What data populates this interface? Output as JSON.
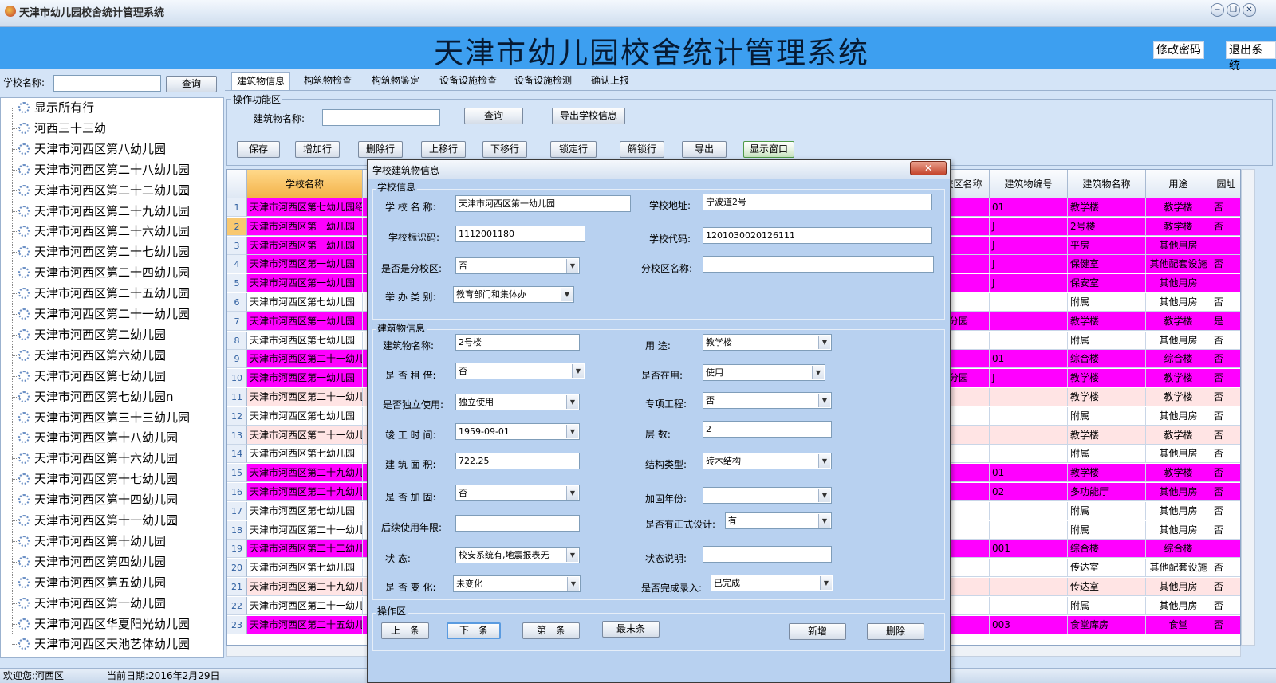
{
  "window": {
    "title": "天津市幼儿园校舍统计管理系统",
    "min": "−",
    "max": "❐",
    "close": "✕"
  },
  "banner": {
    "title": "天津市幼儿园校舍统计管理系统",
    "change_password": "修改密码",
    "logout": "退出系统"
  },
  "left": {
    "school_label": "学校名称:",
    "school_value": "",
    "query": "查询"
  },
  "tree": [
    "显示所有行",
    "河西三十三幼",
    "天津市河西区第八幼儿园",
    "天津市河西区第二十八幼儿园",
    "天津市河西区第二十二幼儿园",
    "天津市河西区第二十九幼儿园",
    "天津市河西区第二十六幼儿园",
    "天津市河西区第二十七幼儿园",
    "天津市河西区第二十四幼儿园",
    "天津市河西区第二十五幼儿园",
    "天津市河西区第二十一幼儿园",
    "天津市河西区第二幼儿园",
    "天津市河西区第六幼儿园",
    "天津市河西区第七幼儿园",
    "天津市河西区第七幼儿园n",
    "天津市河西区第三十三幼儿园",
    "天津市河西区第十八幼儿园",
    "天津市河西区第十六幼儿园",
    "天津市河西区第十七幼儿园",
    "天津市河西区第十四幼儿园",
    "天津市河西区第十一幼儿园",
    "天津市河西区第十幼儿园",
    "天津市河西区第四幼儿园",
    "天津市河西区第五幼儿园",
    "天津市河西区第一幼儿园",
    "天津市河西区华夏阳光幼儿园",
    "天津市河西区天池艺体幼儿园"
  ],
  "tabs": [
    "建筑物信息",
    "构筑物检查",
    "构筑物鉴定",
    "设备设施检查",
    "设备设施检测",
    "确认上报"
  ],
  "ops": {
    "legend": "操作功能区",
    "building_name_label": "建筑物名称:",
    "building_name_value": "",
    "query": "查询",
    "export_school": "导出学校信息",
    "buttons": [
      "保存",
      "增加行",
      "删除行",
      "上移行",
      "下移行",
      "锁定行",
      "解锁行",
      "导出",
      "显示窗口"
    ]
  },
  "grid": {
    "headers": {
      "school": "学校名称",
      "campus": "校区名称",
      "bno": "建筑物编号",
      "bname": "建筑物名称",
      "use": "用途",
      "garden": "园址"
    },
    "rows": [
      {
        "n": "1",
        "school": "天津市河西区第七幼儿园绍",
        "campus": "",
        "bno": "01",
        "bname": "教学楼",
        "use": "教学楼",
        "f": "否",
        "c": "#ff00ff"
      },
      {
        "n": "2",
        "school": "天津市河西区第一幼儿园",
        "campus": "",
        "bno": "J",
        "bname": "2号楼",
        "use": "教学楼",
        "f": "否",
        "c": "#ff00ff"
      },
      {
        "n": "3",
        "school": "天津市河西区第一幼儿园",
        "campus": "",
        "bno": "J",
        "bname": "平房",
        "use": "其他用房",
        "f": "",
        "c": "#ff00ff"
      },
      {
        "n": "4",
        "school": "天津市河西区第一幼儿园",
        "campus": "",
        "bno": "J",
        "bname": "保健室",
        "use": "其他配套设施",
        "f": "否",
        "c": "#ff00ff"
      },
      {
        "n": "5",
        "school": "天津市河西区第一幼儿园",
        "campus": "",
        "bno": "J",
        "bname": "保安室",
        "use": "其他用房",
        "f": "",
        "c": "#ff00ff"
      },
      {
        "n": "6",
        "school": "天津市河西区第七幼儿园",
        "campus": "",
        "bno": "",
        "bname": "附属",
        "use": "其他用房",
        "f": "否",
        "c": "#ffffff"
      },
      {
        "n": "7",
        "school": "天津市河西区第一幼儿园",
        "campus": "园分园",
        "bno": "",
        "bname": "教学楼",
        "use": "教学楼",
        "f": "是",
        "c": "#ff00ff"
      },
      {
        "n": "8",
        "school": "天津市河西区第七幼儿园",
        "campus": "",
        "bno": "",
        "bname": "附属",
        "use": "其他用房",
        "f": "否",
        "c": "#ffffff"
      },
      {
        "n": "9",
        "school": "天津市河西区第二十一幼儿",
        "campus": "",
        "bno": "01",
        "bname": "综合楼",
        "use": "综合楼",
        "f": "否",
        "c": "#ff00ff"
      },
      {
        "n": "10",
        "school": "天津市河西区第一幼儿园",
        "campus": "路分园",
        "bno": "J",
        "bname": "教学楼",
        "use": "教学楼",
        "f": "否",
        "c": "#ff00ff"
      },
      {
        "n": "11",
        "school": "天津市河西区第二十一幼儿",
        "campus": "",
        "bno": "",
        "bname": "教学楼",
        "use": "教学楼",
        "f": "否",
        "c": "#ffe4e4"
      },
      {
        "n": "12",
        "school": "天津市河西区第七幼儿园",
        "campus": "",
        "bno": "",
        "bname": "附属",
        "use": "其他用房",
        "f": "否",
        "c": "#ffffff"
      },
      {
        "n": "13",
        "school": "天津市河西区第二十一幼儿",
        "campus": "",
        "bno": "",
        "bname": "教学楼",
        "use": "教学楼",
        "f": "否",
        "c": "#ffe4e4"
      },
      {
        "n": "14",
        "school": "天津市河西区第七幼儿园",
        "campus": "",
        "bno": "",
        "bname": "附属",
        "use": "其他用房",
        "f": "否",
        "c": "#ffffff"
      },
      {
        "n": "15",
        "school": "天津市河西区第二十九幼儿",
        "campus": "",
        "bno": "01",
        "bname": "教学楼",
        "use": "教学楼",
        "f": "否",
        "c": "#ff00ff"
      },
      {
        "n": "16",
        "school": "天津市河西区第二十九幼儿",
        "campus": "",
        "bno": "02",
        "bname": "多功能厅",
        "use": "其他用房",
        "f": "否",
        "c": "#ff00ff"
      },
      {
        "n": "17",
        "school": "天津市河西区第七幼儿园",
        "campus": "",
        "bno": "",
        "bname": "附属",
        "use": "其他用房",
        "f": "否",
        "c": "#ffffff"
      },
      {
        "n": "18",
        "school": "天津市河西区第二十一幼儿",
        "campus": "",
        "bno": "",
        "bname": "附属",
        "use": "其他用房",
        "f": "否",
        "c": "#ffffff"
      },
      {
        "n": "19",
        "school": "天津市河西区第二十二幼儿",
        "campus": "",
        "bno": "001",
        "bname": "综合楼",
        "use": "综合楼",
        "f": "",
        "c": "#ff00ff"
      },
      {
        "n": "20",
        "school": "天津市河西区第七幼儿园",
        "campus": "",
        "bno": "",
        "bname": "传达室",
        "use": "其他配套设施",
        "f": "否",
        "c": "#ffffff"
      },
      {
        "n": "21",
        "school": "天津市河西区第二十九幼儿",
        "campus": "",
        "bno": "",
        "bname": "传达室",
        "use": "其他用房",
        "f": "否",
        "c": "#ffe4e4"
      },
      {
        "n": "22",
        "school": "天津市河西区第二十一幼儿",
        "campus": "",
        "bno": "",
        "bname": "附属",
        "use": "其他用房",
        "f": "否",
        "c": "#ffffff"
      },
      {
        "n": "23",
        "school": "天津市河西区第二十五幼儿",
        "campus": "",
        "bno": "003",
        "bname": "食堂库房",
        "use": "食堂",
        "f": "否",
        "c": "#ff00ff"
      }
    ]
  },
  "status": {
    "welcome": "欢迎您:河西区",
    "date": "当前日期:2016年2月29日"
  },
  "modal": {
    "title": "学校建筑物信息",
    "close": "✕",
    "school_group": "学校信息",
    "building_group": "建筑物信息",
    "op_group": "操作区",
    "fields": {
      "school_name_label": "学 校 名 称:",
      "school_name": "天津市河西区第一幼儿园",
      "address_label": "学校地址:",
      "address": "宁波道2号",
      "school_id_label": "学校标识码:",
      "school_id": "1112001180",
      "school_code_label": "学校代码:",
      "school_code": "1201030020126111",
      "is_branch_label": "是否是分校区:",
      "is_branch": "否",
      "branch_name_label": "分校区名称:",
      "branch_name": "",
      "run_type_label": "举 办 类 别:",
      "run_type": "教育部门和集体办",
      "bname_label": "建筑物名称:",
      "bname": "2号楼",
      "use_label": "用       途:",
      "use": "教学楼",
      "rent_label": "是 否 租 借:",
      "rent": "否",
      "in_use_label": "是否在用:",
      "in_use": "使用",
      "independent_label": "是否独立使用:",
      "independent": "独立使用",
      "special_label": "专项工程:",
      "special": "否",
      "complete_label": "竣 工 时 间:",
      "complete": "1959-09-01",
      "floors_label": "层       数:",
      "floors": "2",
      "area_label": "建 筑 面 积:",
      "area": "722.25",
      "structure_label": "结构类型:",
      "structure": "砖木结构",
      "reinforce_label": "是 否 加 固:",
      "reinforce": "否",
      "reinforce_year_label": "加固年份:",
      "reinforce_year": "",
      "life_label": "后续使用年限:",
      "life": "",
      "formal_design_label": "是否有正式设计:",
      "formal_design": "有",
      "state_label": "状       态:",
      "state": "校安系统有,地震报表无",
      "state_desc_label": "状态说明:",
      "state_desc": "",
      "changed_label": "是 否 变 化:",
      "changed": "未变化",
      "done_label": "是否完成录入:",
      "done": "已完成"
    },
    "buttons": {
      "prev": "上一条",
      "next": "下一条",
      "first": "第一条",
      "last": "最末条",
      "add": "新增",
      "delete": "删除"
    }
  }
}
